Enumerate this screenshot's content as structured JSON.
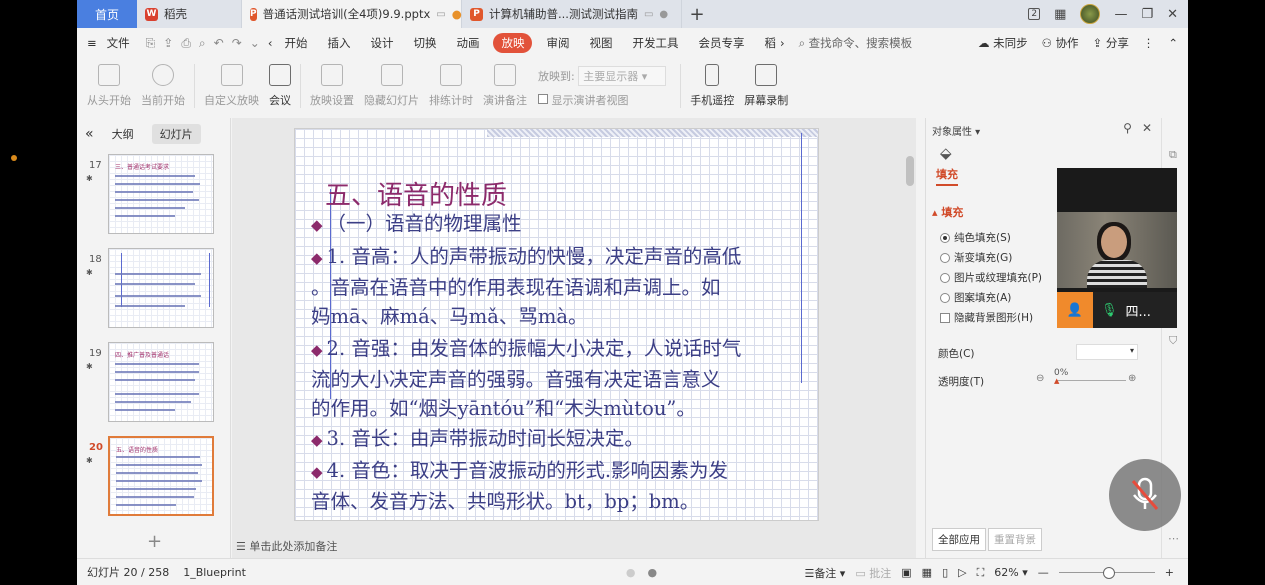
{
  "tabs": {
    "home": "首页",
    "wps": "稻壳",
    "doc1": "普通话测试培训(全4项)9.9.pptx",
    "doc2": "计算机辅助普...测试测试指南",
    "window_badge": "2"
  },
  "menu": {
    "file": "文件",
    "items": [
      "开始",
      "插入",
      "设计",
      "切换",
      "动画",
      "放映",
      "审阅",
      "视图",
      "开发工具",
      "会员专享",
      "稻"
    ],
    "active": "放映",
    "search": "查找命令、搜索模板",
    "sync": "未同步",
    "collab": "协作",
    "share": "分享"
  },
  "ribbon": {
    "from_start": "从头开始",
    "current": "当前开始",
    "custom": "自定义放映",
    "meeting": "会议",
    "settings": "放映设置",
    "hide": "隐藏幻灯片",
    "rehearse": "排练计时",
    "notes": "演讲备注",
    "play_to_label": "放映到:",
    "play_to_value": "主要显示器",
    "presenter_view": "显示演讲者视图",
    "remote": "手机遥控",
    "record": "屏幕录制"
  },
  "left_panel": {
    "tab_outline": "大纲",
    "tab_slides": "幻灯片",
    "slides": [
      {
        "num": "17",
        "title": "三、普通话考试要求"
      },
      {
        "num": "18",
        "title": ""
      },
      {
        "num": "19",
        "title": "四、推广普及普通话"
      },
      {
        "num": "20",
        "title": "五、语音的性质"
      }
    ]
  },
  "slide": {
    "title": "五、语音的性质",
    "lines": [
      "（一）语音的物理属性",
      "1. 音高：人的声带振动的快慢，决定声音的高低",
      "。音高在语音中的作用表现在语调和声调上。如",
      "妈mā、麻má、马mǎ、骂mà。",
      "2. 音强：由发音体的振幅大小决定，人说话时气",
      "流的大小决定声音的强弱。音强有决定语言意义",
      "的作用。如“烟头yāntóu”和“木头mùtou”。",
      "3. 音长：由声带振动时间长短决定。",
      "4. 音色：取决于音波振动的形式.影响因素为发",
      "音体、发音方法、共鸣形状。bt，bp；bm。"
    ]
  },
  "notes_hint": "单击此处添加备注",
  "right_panel": {
    "title": "对象属性",
    "tab": "填充",
    "section": "填充",
    "options": [
      "纯色填充(S)",
      "渐变填充(G)",
      "图片或纹理填充(P)",
      "图案填充(A)"
    ],
    "hide_bg": "隐藏背景图形(H)",
    "color_label": "颜色(C)",
    "transparency_label": "透明度(T)",
    "transparency_value": "0%",
    "apply_all": "全部应用",
    "reset_bg": "重置背景"
  },
  "video": {
    "name": "四..."
  },
  "status": {
    "slide_info": "幻灯片 20 / 258",
    "theme": "1_Blueprint",
    "notes": "备注",
    "comments": "批注",
    "zoom": "62%"
  }
}
